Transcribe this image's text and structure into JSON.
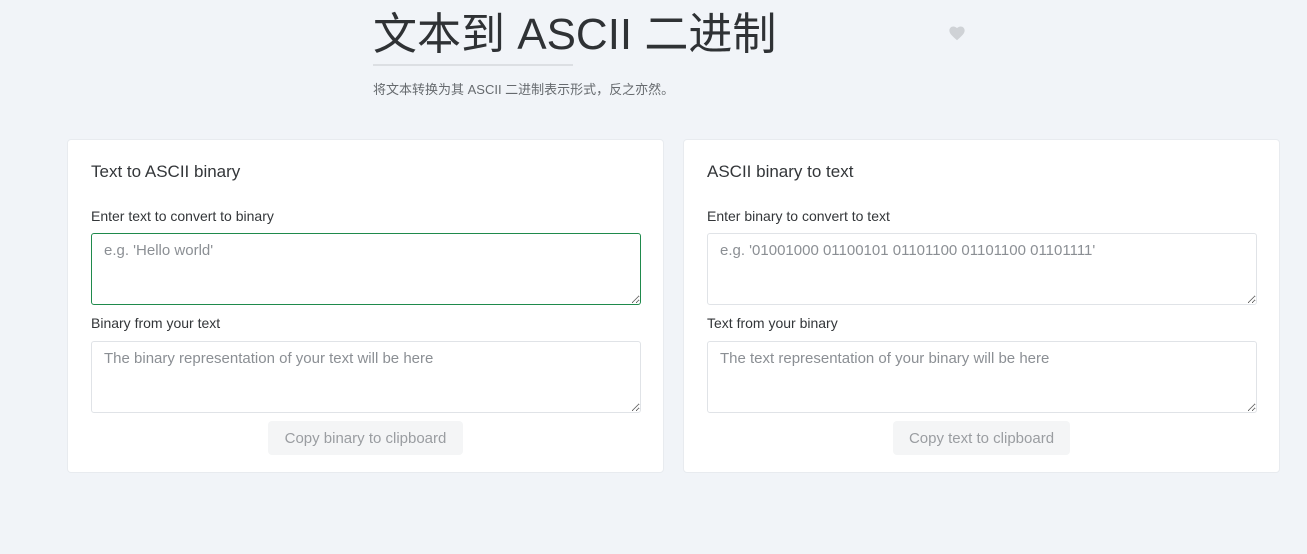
{
  "header": {
    "title": "文本到 ASCII 二进制",
    "subtitle": "将文本转换为其 ASCII 二进制表示形式，反之亦然。",
    "favorite_icon": "heart-icon"
  },
  "text_to_binary": {
    "title": "Text to ASCII binary",
    "input_label": "Enter text to convert to binary",
    "input_placeholder": "e.g. 'Hello world'",
    "input_value": "",
    "output_label": "Binary from your text",
    "output_placeholder": "The binary representation of your text will be here",
    "output_value": "",
    "copy_label": "Copy binary to clipboard"
  },
  "binary_to_text": {
    "title": "ASCII binary to text",
    "input_label": "Enter binary to convert to text",
    "input_placeholder": "e.g. '01001000 01100101 01101100 01101100 01101111'",
    "input_value": "",
    "output_label": "Text from your binary",
    "output_placeholder": "The text representation of your binary will be here",
    "output_value": "",
    "copy_label": "Copy text to clipboard"
  },
  "colors": {
    "background": "#f1f4f8",
    "focus_border": "#1f8a4c",
    "card": "#ffffff"
  }
}
